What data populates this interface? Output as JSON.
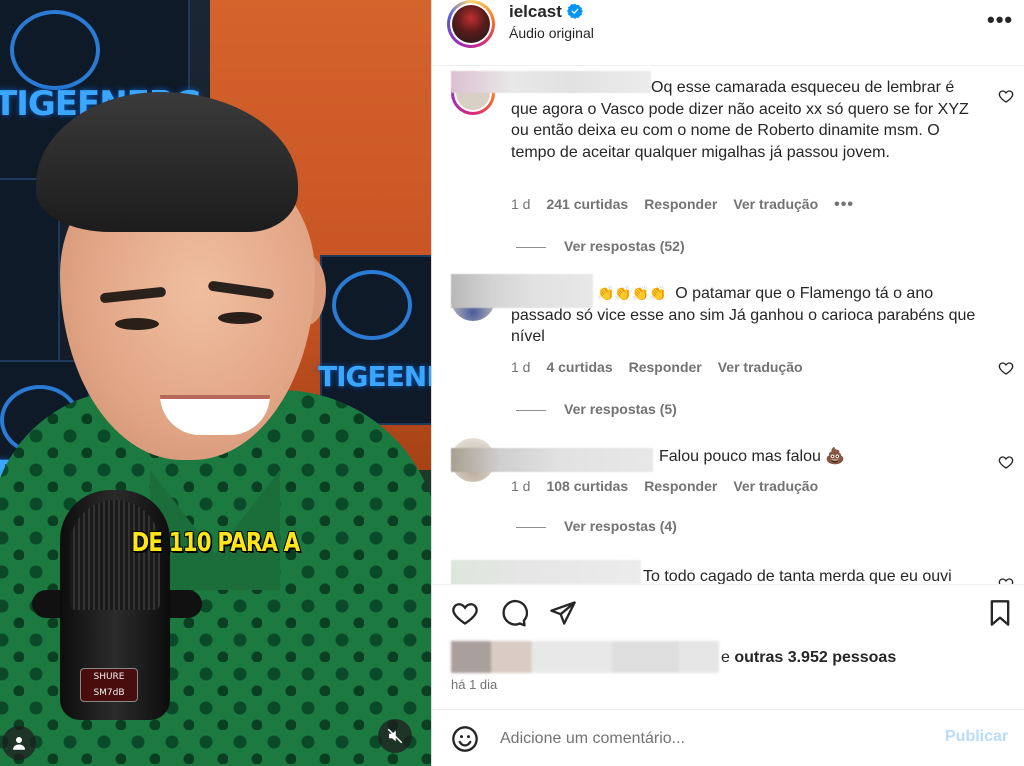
{
  "video": {
    "caption": "DE 110 PARA A",
    "wall_text": "TIGEENERG",
    "mic_brand": "SHURE",
    "mic_model": "SM7dB"
  },
  "header": {
    "username": "ielcast",
    "subtitle": "Áudio original"
  },
  "comments": [
    {
      "text": "Oq esse camarada esqueceu de lembrar é que agora o Vasco pode dizer não aceito xx só quero se for XYZ ou então deixa eu com o nome de Roberto dinamite msm. O tempo de aceitar qualquer migalhas já passou jovem.",
      "age": "1 d",
      "likes": "241 curtidas",
      "reply": "Responder",
      "translate": "Ver tradução",
      "more": "•••",
      "replies": "Ver respostas (52)"
    },
    {
      "emoji": "👏👏👏👏",
      "text": "O patamar que o Flamengo tá o ano passado só vice esse ano sim Já ganhou o carioca parabéns que nível",
      "age": "1 d",
      "likes": "4 curtidas",
      "reply": "Responder",
      "translate": "Ver tradução",
      "replies": "Ver respostas (5)"
    },
    {
      "text": "Falou pouco mas falou 💩",
      "age": "1 d",
      "likes": "108 curtidas",
      "reply": "Responder",
      "translate": "Ver tradução",
      "replies": "Ver respostas (4)"
    },
    {
      "text": "To todo cagado de tanta merda que eu ouvi"
    }
  ],
  "likes": {
    "suffix": "e",
    "others": "outras 3.952 pessoas"
  },
  "time": "há 1 dia",
  "add_comment": {
    "placeholder": "Adicione um comentário...",
    "publish": "Publicar"
  },
  "colors": {
    "accent_disabled": "#b9dcfb",
    "muted_text": "#737373",
    "verified_blue": "#0095f6"
  }
}
